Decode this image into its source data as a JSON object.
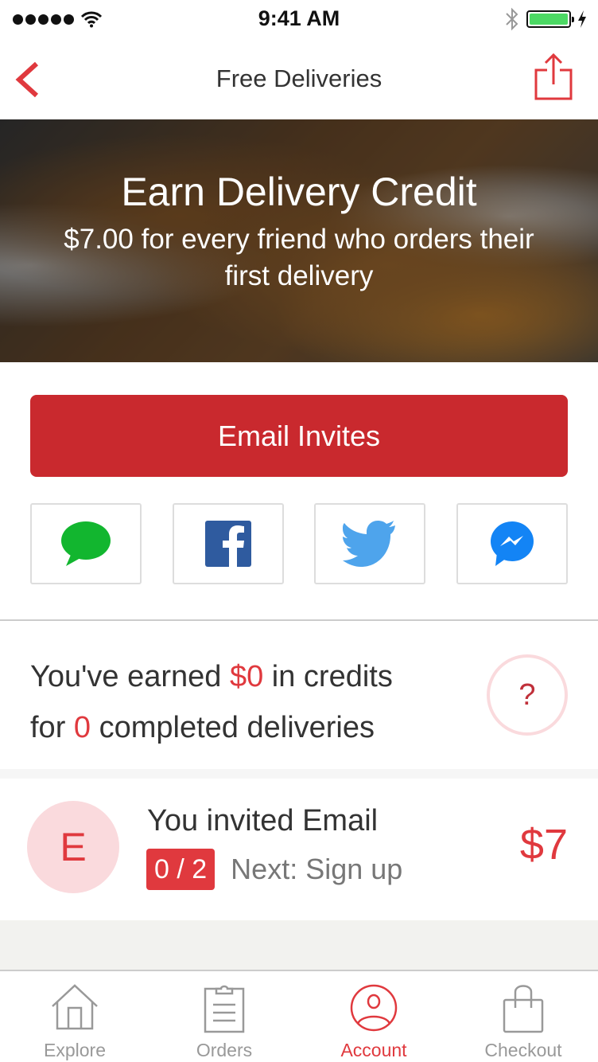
{
  "status_bar": {
    "time": "9:41 AM",
    "signal_icon": "signal-dots-icon",
    "wifi_icon": "wifi-icon",
    "bluetooth_icon": "bluetooth-icon",
    "battery_icon": "battery-icon",
    "charging_icon": "bolt-icon"
  },
  "nav": {
    "title": "Free Deliveries",
    "back_icon": "chevron-left-icon",
    "share_icon": "share-icon"
  },
  "hero": {
    "title": "Earn Delivery Credit",
    "subtitle": "$7.00 for every friend who orders their first delivery"
  },
  "email_button": {
    "label": "Email Invites"
  },
  "share_options": [
    {
      "name": "messages",
      "icon": "message-bubble-icon",
      "color": "#12b62f"
    },
    {
      "name": "facebook",
      "icon": "facebook-icon",
      "color": "#2f5b9f"
    },
    {
      "name": "twitter",
      "icon": "twitter-icon",
      "color": "#4ea4ec"
    },
    {
      "name": "messenger",
      "icon": "messenger-icon",
      "color": "#1384f5"
    }
  ],
  "earned": {
    "prefix": "You've earned ",
    "amount": "$0",
    "middle": " in credits",
    "line2_prefix": "for ",
    "count": "0",
    "line2_suffix": " completed deliveries",
    "help_label": "?"
  },
  "invites": [
    {
      "avatar_letter": "E",
      "title": "You invited Email",
      "progress": "0 / 2",
      "next_step": "Next: Sign up",
      "reward": "$7"
    }
  ],
  "tabs": [
    {
      "label": "Explore",
      "icon": "home-icon",
      "active": false
    },
    {
      "label": "Orders",
      "icon": "clipboard-icon",
      "active": false
    },
    {
      "label": "Account",
      "icon": "user-circle-icon",
      "active": true
    },
    {
      "label": "Checkout",
      "icon": "shopping-bag-icon",
      "active": false
    }
  ],
  "colors": {
    "accent": "#e0393e",
    "button_red": "#c9292e",
    "avatar_bg": "#fadadd",
    "battery_green": "#4cd964"
  }
}
